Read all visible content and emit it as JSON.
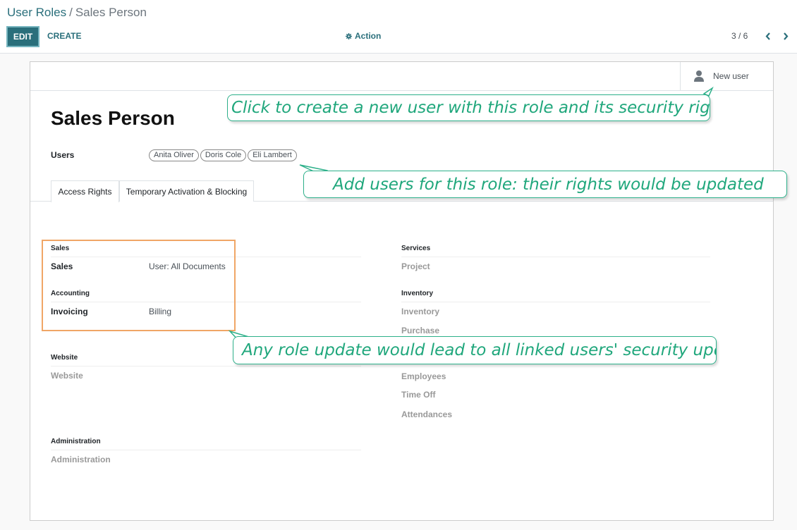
{
  "breadcrumb": {
    "parent": "User Roles",
    "separator": "/",
    "current": "Sales Person"
  },
  "toolbar": {
    "edit_label": "EDIT",
    "create_label": "CREATE",
    "action_label": "Action"
  },
  "pager": {
    "value": "3 / 6"
  },
  "stat_button": {
    "label": "New user"
  },
  "form": {
    "title": "Sales Person",
    "users_label": "Users",
    "users": [
      "Anita Oliver",
      "Doris Cole",
      "Eli Lambert"
    ]
  },
  "tabs": [
    {
      "label": "Access Rights",
      "active": true
    },
    {
      "label": "Temporary Activation & Blocking",
      "active": false
    }
  ],
  "groups": {
    "sales": {
      "title": "Sales",
      "field": "Sales",
      "value": "User: All Documents"
    },
    "accounting": {
      "title": "Accounting",
      "field": "Invoicing",
      "value": "Billing"
    },
    "website": {
      "title": "Website",
      "field": "Website"
    },
    "administration": {
      "title": "Administration",
      "field": "Administration"
    },
    "services": {
      "title": "Services",
      "field": "Project"
    },
    "inventory": {
      "title": "Inventory",
      "fields": [
        "Inventory",
        "Purchase"
      ]
    },
    "hr_fields": [
      "Employees",
      "Time Off",
      "Attendances"
    ]
  },
  "callouts": {
    "new_user": "Click to create a new user with this role and its security rights",
    "add_users": "Add users for this role: their rights would be updated",
    "role_update": "Any role update would lead to all linked users' security update"
  },
  "colors": {
    "accent": "#2a6f7b",
    "callout": "#20a77c",
    "highlight": "#f0a666"
  }
}
